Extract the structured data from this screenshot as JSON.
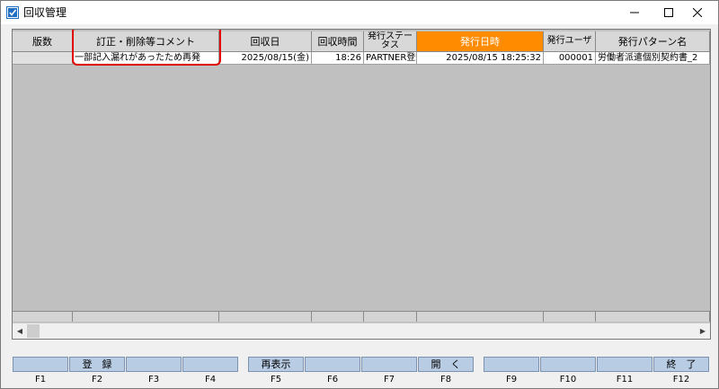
{
  "window": {
    "title": "回収管理",
    "controls": {
      "minimize": "minimize-icon",
      "maximize": "maximize-icon",
      "close": "close-icon"
    }
  },
  "grid": {
    "columns": [
      {
        "label": "版数"
      },
      {
        "label": "訂正・削除等コメント"
      },
      {
        "label": "回収日"
      },
      {
        "label": "回収時間"
      },
      {
        "label": "発行ステータス"
      },
      {
        "label": "発行日時"
      },
      {
        "label": "発行ユーザ"
      },
      {
        "label": "発行パターン名"
      }
    ],
    "rows": [
      {
        "version": "",
        "comment": "一部記入漏れがあったため再発",
        "collect_date": "2025/08/15(金)",
        "collect_time": "18:26",
        "status": "PARTNER登録",
        "issue_datetime": "2025/08/15 18:25:32",
        "issue_user": "000001",
        "pattern_name": "労働者派遣個別契約書_2"
      }
    ]
  },
  "colors": {
    "active_header": "#ff8c00",
    "highlight_border": "#e00000",
    "fkey_button": "#b8cce4"
  },
  "fkeys": [
    {
      "key": "F1",
      "label": ""
    },
    {
      "key": "F2",
      "label": "登　録"
    },
    {
      "key": "F3",
      "label": ""
    },
    {
      "key": "F4",
      "label": ""
    },
    {
      "key": "F5",
      "label": "再表示"
    },
    {
      "key": "F6",
      "label": ""
    },
    {
      "key": "F7",
      "label": ""
    },
    {
      "key": "F8",
      "label": "開　く"
    },
    {
      "key": "F9",
      "label": ""
    },
    {
      "key": "F10",
      "label": ""
    },
    {
      "key": "F11",
      "label": ""
    },
    {
      "key": "F12",
      "label": "終　了"
    }
  ]
}
